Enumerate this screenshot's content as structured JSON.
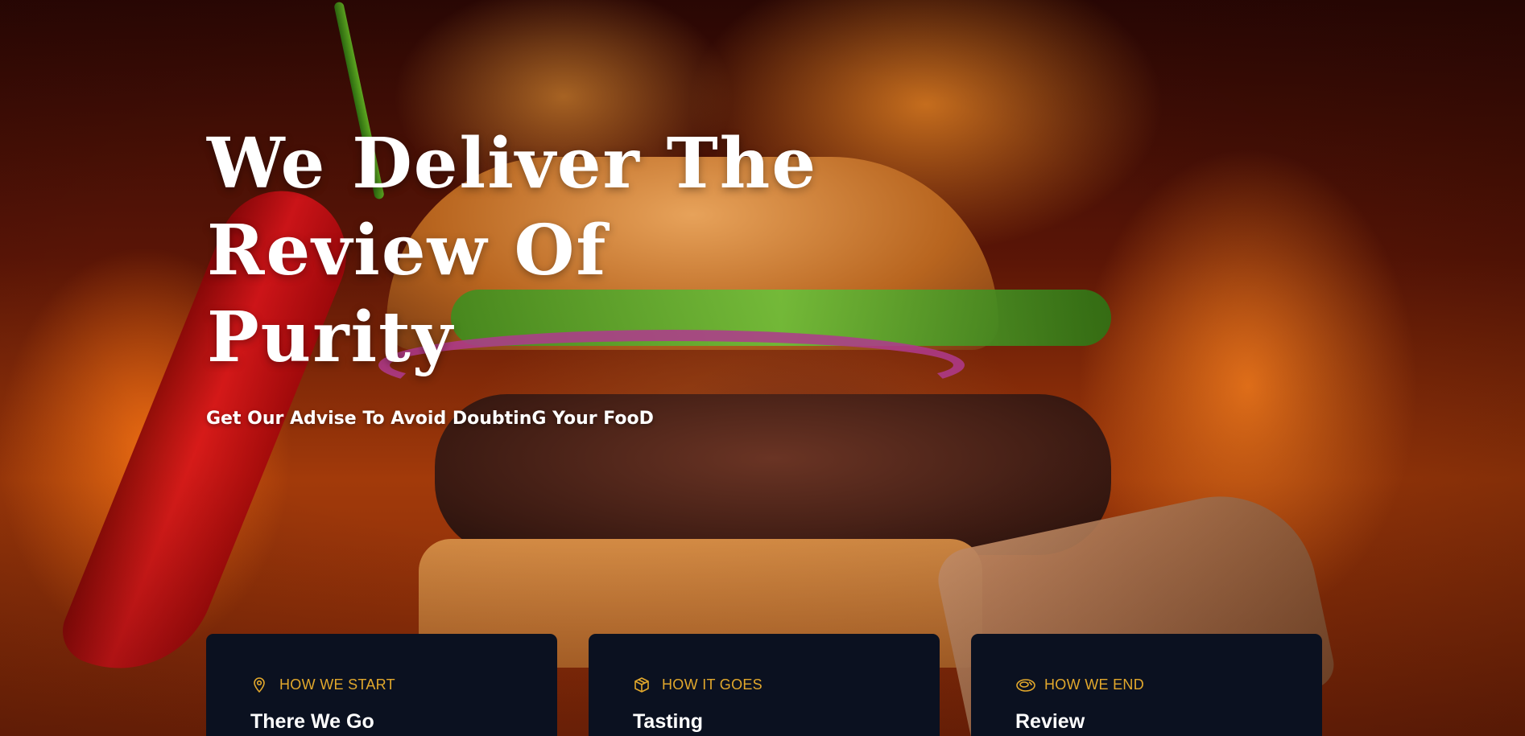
{
  "hero": {
    "title_lines": [
      "We Deliver The",
      "Review Of",
      "Purity"
    ],
    "subtitle": "Get Our Advise To Avoid DoubtinG Your FooD"
  },
  "cards": [
    {
      "label": "HOW WE START",
      "heading": "There We Go",
      "icon": "location-pin-icon"
    },
    {
      "label": "HOW IT GOES",
      "heading": "Tasting",
      "icon": "box-icon"
    },
    {
      "label": "HOW WE END",
      "heading": "Review",
      "icon": "food-dish-icon"
    }
  ],
  "colors": {
    "card_background": "#0b1120",
    "accent": "#e2a82c",
    "title_text": "#ffffff"
  }
}
